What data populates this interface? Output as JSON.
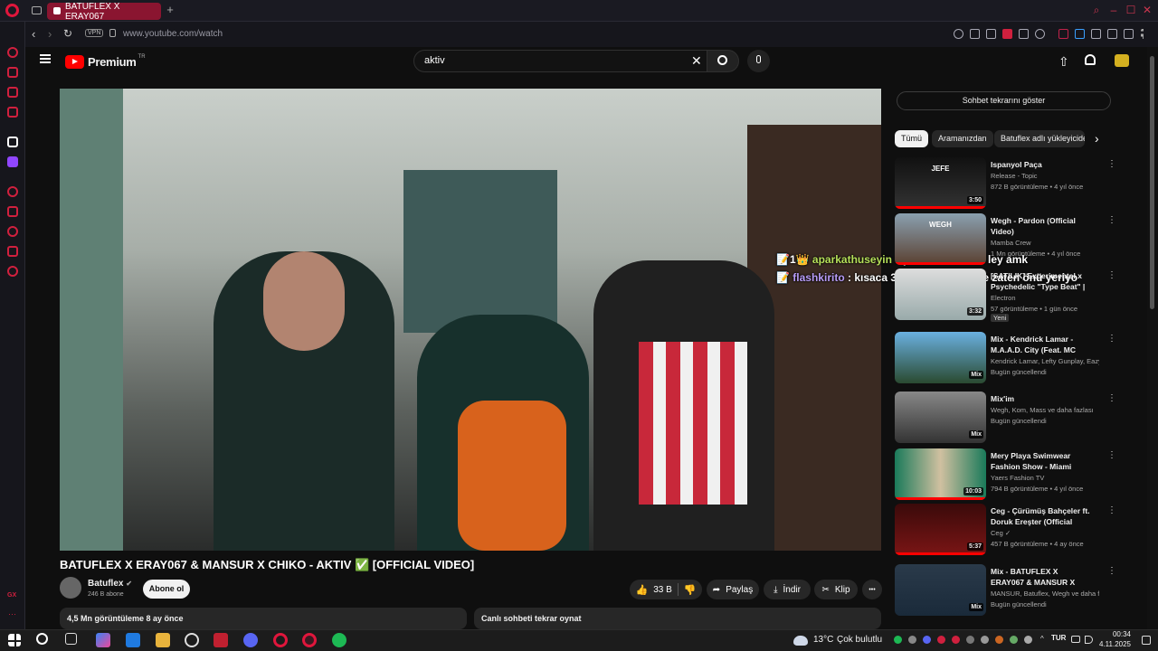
{
  "browser": {
    "tab_title": "BATUFLEX X ERAY067",
    "new_tab": "+",
    "url": "www.youtube.com/watch",
    "vpn": "VPN"
  },
  "youtube": {
    "logo_text": "Premium",
    "logo_sup": "TR",
    "search_value": "aktiv",
    "video_title": "BATUFLEX X ERAY067 & MANSUR X CHIKO - AKTIV ✅ [OFFICIAL VIDEO]",
    "channel_name": "Batuflex",
    "subscribers": "246 B abone",
    "subscribe": "Abone ol",
    "likes": "33 B",
    "share": "Paylaş",
    "download": "İndir",
    "clip": "Klip",
    "more": "•••",
    "views_line": "4,5 Mn görüntüleme  8 ay önce",
    "live_replay": "Canlı sohbeti tekrar oynat",
    "show_chat": "Sohbet tekrarını göster",
    "chips": [
      "Tümü",
      "Aramanızdan",
      "Batuflex adlı yükleyiciden"
    ]
  },
  "chat_overlay": [
    {
      "user": "aparkathuseyin",
      "text": ": çıkartsın artık bi ley amk",
      "user_color": "#b6e05a",
      "badges": "📝1👑"
    },
    {
      "user": "flashkirito",
      "text": ": kısaca 3ün1i :D hayat bize zaten önü yeriyo",
      "user_color": "#b79cf7",
      "badges": "📝"
    }
  ],
  "recommendations": [
    {
      "title": "Ispanyol Paça",
      "channel": "Release - Topic",
      "meta": "872 B görüntüleme • 4 yıl önce",
      "duration": "3:50",
      "thumb_text": "JEFE",
      "progress": true
    },
    {
      "title": "Wegh - Pardon (Official Video)",
      "channel": "Mamba Crew",
      "meta": "1 Mn görüntüleme • 4 yıl önce",
      "duration": "",
      "thumb_text": "WEGH",
      "progress": true
    },
    {
      "title": "[SATILIK] Experimental x Psychedelic \"Type Beat\" | ...",
      "channel": "Electron",
      "meta": "57 görüntüleme • 1 gün önce",
      "duration": "3:32",
      "thumb_text": "",
      "badge": "Yeni",
      "progress": false
    },
    {
      "title": "Mix - Kendrick Lamar - M.A.A.D. City (Feat. MC eiht)",
      "channel": "Kendrick Lamar, Lefty Gunplay, Eazy-E ve...",
      "meta": "Bugün güncellendi",
      "duration": "Mix",
      "thumb_text": "",
      "progress": false
    },
    {
      "title": "Mix'im",
      "channel": "Wegh, Kom, Mass ve daha fazlası",
      "meta": "Bugün güncellendi",
      "duration": "Mix",
      "thumb_text": "",
      "progress": false
    },
    {
      "title": "Mery Playa Swimwear Fashion Show - Miami Swim Week 202...",
      "channel": "Yaers Fashion TV",
      "meta": "794 B görüntüleme • 4 yıl önce",
      "duration": "10:03",
      "thumb_text": "",
      "progress": true
    },
    {
      "title": "Ceg - Çürümüş Bahçeler ft. Doruk Ereşter (Official Lyric ...",
      "channel": "Ceg ✓",
      "meta": "457 B görüntüleme • 4 ay önce",
      "duration": "5:37",
      "thumb_text": "",
      "progress": true
    },
    {
      "title": "Mix - BATUFLEX X ERAY067 & MANSUR X CHIKO - AKTIV ✅...",
      "channel": "MANSUR, Batuflex, Wegh ve daha fazlası",
      "meta": "Bugün güncellendi",
      "duration": "Mix",
      "thumb_text": "",
      "progress": false
    }
  ],
  "taskbar": {
    "weather_temp": "13°C",
    "weather_text": "Çok bulutlu",
    "lang": "TUR",
    "time": "00:34",
    "date": "4.11.2025"
  },
  "colors": {
    "accent": "#ff0000",
    "opera": "#e0163c",
    "chip_active": "#f1f1f1"
  }
}
